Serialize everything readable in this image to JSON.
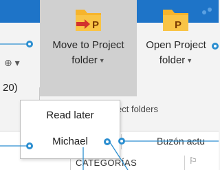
{
  "window": {
    "titlebar_color": "#1e74c8"
  },
  "ribbon": {
    "left_partial_value": "20)",
    "buttons": [
      {
        "line1": "Move to Project",
        "line2": "folder",
        "icon": "move-to-project-folder-icon",
        "badge": "P",
        "highlighted": true
      },
      {
        "line1": "Open Project",
        "line2": "folder",
        "icon": "open-project-folder-icon",
        "badge": "P",
        "highlighted": false
      }
    ],
    "group_label_suffix": "ect folders"
  },
  "dropdown": {
    "items": [
      "Read later",
      "Michael"
    ]
  },
  "search_bar": {
    "right_text": "Buzón actu"
  },
  "columns": {
    "category": "CATEGORÍAS"
  },
  "colors": {
    "accent": "#2b8ed0",
    "folder": "#f6b42c",
    "badge_text": "#7a3a00"
  }
}
